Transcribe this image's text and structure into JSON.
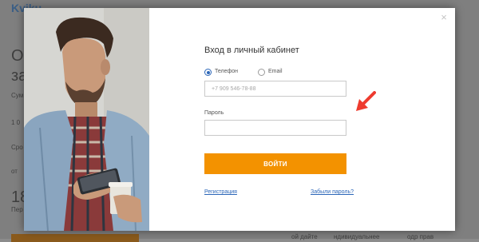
{
  "background": {
    "logo_text": "Kviku",
    "left_texts": [
      "О",
      "за",
      "Сум",
      "1 0",
      "Сро",
      "от",
      "18",
      "Пер"
    ],
    "bottom_links": [
      "ой дайте",
      "ндивидуальнее",
      "одр прав"
    ]
  },
  "modal": {
    "close_label": "×",
    "title": "Вход в личный кабинет",
    "radios": [
      {
        "label": "Телефон",
        "checked": true
      },
      {
        "label": "Email",
        "checked": false
      }
    ],
    "phone_placeholder": "+7 909 546-78-88",
    "password_label": "Пароль",
    "password_value": "",
    "submit_label": "ВОЙТИ",
    "register_link": "Регистрация",
    "forgot_link": "Забыли пароль?"
  },
  "colors": {
    "accent": "#f39200",
    "link": "#2b66b8",
    "overlay": "#7f7f7f",
    "arrow": "#ee3b2f"
  }
}
